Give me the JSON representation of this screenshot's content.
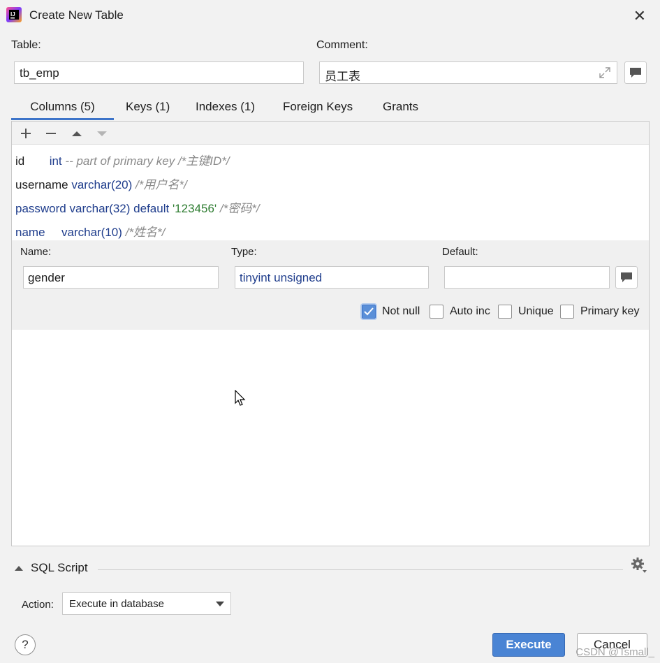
{
  "window": {
    "title": "Create New Table",
    "icon": "intellij-idea-icon",
    "close_icon": "close-icon"
  },
  "form": {
    "table_label": "Table:",
    "table_value": "tb_emp",
    "comment_label": "Comment:",
    "comment_value": "员工表"
  },
  "tabs": [
    {
      "label": "Columns (5)",
      "active": true
    },
    {
      "label": "Keys (1)",
      "active": false
    },
    {
      "label": "Indexes (1)",
      "active": false
    },
    {
      "label": "Foreign Keys",
      "active": false
    },
    {
      "label": "Grants",
      "active": false
    }
  ],
  "toolbar": {
    "add_icon": "plus-icon",
    "remove_icon": "minus-icon",
    "up_icon": "arrow-up-icon",
    "down_icon": "arrow-down-icon"
  },
  "columns": [
    {
      "name": "id",
      "type": "int",
      "extra": "",
      "comment": "-- part of primary key /*主键ID*/"
    },
    {
      "name": "username",
      "type": "varchar(20)",
      "extra": "",
      "comment": "/*用户名*/"
    },
    {
      "name": "password",
      "type": "varchar(32)",
      "extra_kw": "default",
      "extra_str": "'123456'",
      "comment": "/*密码*/"
    },
    {
      "name": "name",
      "type": "varchar(10)",
      "extra": "",
      "comment": "/*姓名*/"
    }
  ],
  "editor": {
    "name_label": "Name:",
    "name_value": "gender",
    "type_label": "Type:",
    "type_value": "tinyint unsigned",
    "default_label": "Default:",
    "default_value": "",
    "checkboxes": [
      {
        "label": "Not null",
        "checked": true
      },
      {
        "label": "Auto inc",
        "checked": false
      },
      {
        "label": "Unique",
        "checked": false
      },
      {
        "label": "Primary key",
        "checked": false
      }
    ]
  },
  "sql_script": {
    "label": "SQL Script",
    "action_label": "Action:",
    "action_value": "Execute in database"
  },
  "buttons": {
    "help": "?",
    "execute": "Execute",
    "cancel": "Cancel"
  },
  "watermark": "CSDN @Tsmall_",
  "colors": {
    "accent": "#3d74c9",
    "execute_bg": "#4a84d4",
    "type_blue": "#1f3d8c",
    "string_green": "#2f7d32",
    "comment_gray": "#8a8a8a"
  }
}
